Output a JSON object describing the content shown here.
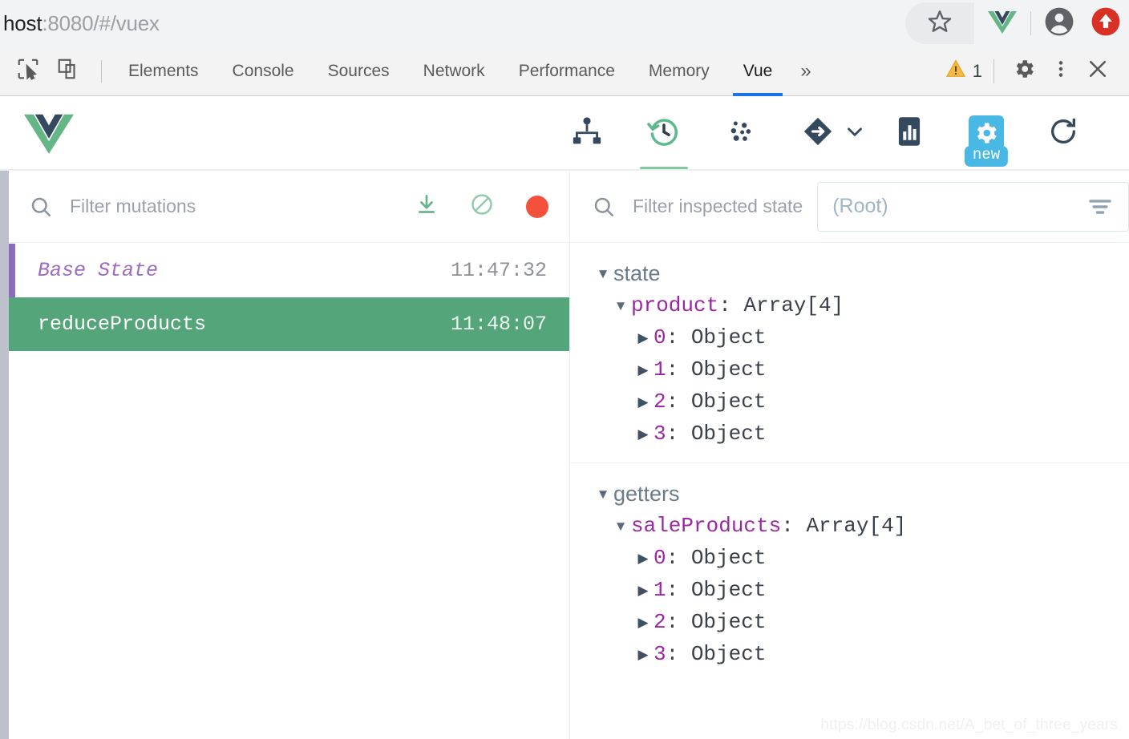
{
  "browser": {
    "url_prefix": "host",
    "url_suffix": ":8080/#/vuex",
    "url_full": "host:8080/#/vuex",
    "star_icon": "bookmark-star-icon",
    "extension_icon": "vue-extension-icon",
    "profile_icon": "profile-avatar-icon",
    "update_icon": "update-arrow-icon"
  },
  "devtools": {
    "inspect_icon": "inspect-element-icon",
    "device_icon": "device-toolbar-icon",
    "tabs": [
      {
        "label": "Elements",
        "active": false
      },
      {
        "label": "Console",
        "active": false
      },
      {
        "label": "Sources",
        "active": false
      },
      {
        "label": "Network",
        "active": false
      },
      {
        "label": "Performance",
        "active": false
      },
      {
        "label": "Memory",
        "active": false
      },
      {
        "label": "Vue",
        "active": true
      }
    ],
    "more_tabs": "»",
    "warning_count": "1",
    "warning_icon": "warning-triangle-icon",
    "settings_icon": "gear-icon",
    "kebab_icon": "more-vertical-icon",
    "close_icon": "close-icon",
    "accent": "#1a73e8"
  },
  "vue_header": {
    "logo": "vue-logo-icon",
    "tools": [
      {
        "name": "components-tree-icon",
        "active": false
      },
      {
        "name": "vuex-history-icon",
        "active": true
      },
      {
        "name": "events-icon",
        "active": false
      },
      {
        "name": "routing-icon",
        "active": false
      },
      {
        "name": "performance-bar-icon",
        "active": false
      },
      {
        "name": "settings-gear-icon",
        "active": false,
        "badge": "new"
      },
      {
        "name": "refresh-icon",
        "active": false
      }
    ],
    "chevron_icon": "chevron-down-icon",
    "badge_color": "#49b8e5",
    "active_underline": "#82c7a2"
  },
  "left_panel": {
    "filter_placeholder": "Filter mutations",
    "search_icon": "search-icon",
    "actions": [
      {
        "name": "export-icon",
        "color": "#6bb58c"
      },
      {
        "name": "clear-disabled-icon",
        "color": "#8fcaab"
      },
      {
        "name": "record-dot-icon",
        "color": "#f4503c"
      }
    ],
    "mutations": [
      {
        "name": "Base State",
        "time": "11:47:32",
        "kind": "base",
        "marker_color": "#8a6bbd"
      },
      {
        "name": "reduceProducts",
        "time": "11:48:07",
        "kind": "active",
        "row_color": "#55a57b"
      }
    ]
  },
  "right_panel": {
    "filter_placeholder": "Filter inspected state",
    "search_icon": "search-icon",
    "root_value": "(Root)",
    "root_filter_icon": "filter-lines-icon",
    "sections": [
      {
        "title": "state",
        "expanded": true,
        "entries": [
          {
            "key": "product",
            "value": "Array[4]",
            "expanded": true,
            "children": [
              {
                "key": "0",
                "value": "Object"
              },
              {
                "key": "1",
                "value": "Object"
              },
              {
                "key": "2",
                "value": "Object"
              },
              {
                "key": "3",
                "value": "Object"
              }
            ]
          }
        ]
      },
      {
        "title": "getters",
        "expanded": true,
        "entries": [
          {
            "key": "saleProducts",
            "value": "Array[4]",
            "expanded": true,
            "children": [
              {
                "key": "0",
                "value": "Object"
              },
              {
                "key": "1",
                "value": "Object"
              },
              {
                "key": "2",
                "value": "Object"
              },
              {
                "key": "3",
                "value": "Object"
              }
            ]
          }
        ]
      }
    ]
  },
  "watermark": "https://blog.csdn.net/A_bet_of_three_years"
}
